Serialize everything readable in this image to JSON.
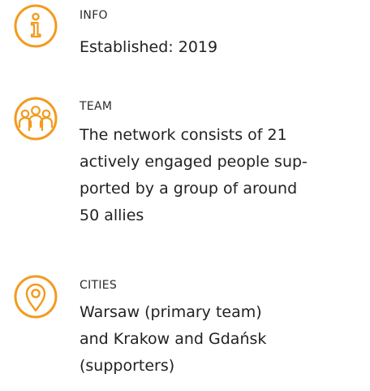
{
  "accent_color": "#F39A1E",
  "items": [
    {
      "icon": "info-icon",
      "label": "INFO",
      "lines": [
        "Established: 2019"
      ]
    },
    {
      "icon": "team-icon",
      "label": "TEAM",
      "lines": [
        "The network consists of 21",
        "actively engaged people sup-",
        "ported by a group of around",
        "50 allies"
      ]
    },
    {
      "icon": "location-pin-icon",
      "label": "CITIES",
      "lines": [
        "Warsaw (primary team)",
        "and Krakow and Gdańsk",
        "(supporters)"
      ]
    }
  ]
}
